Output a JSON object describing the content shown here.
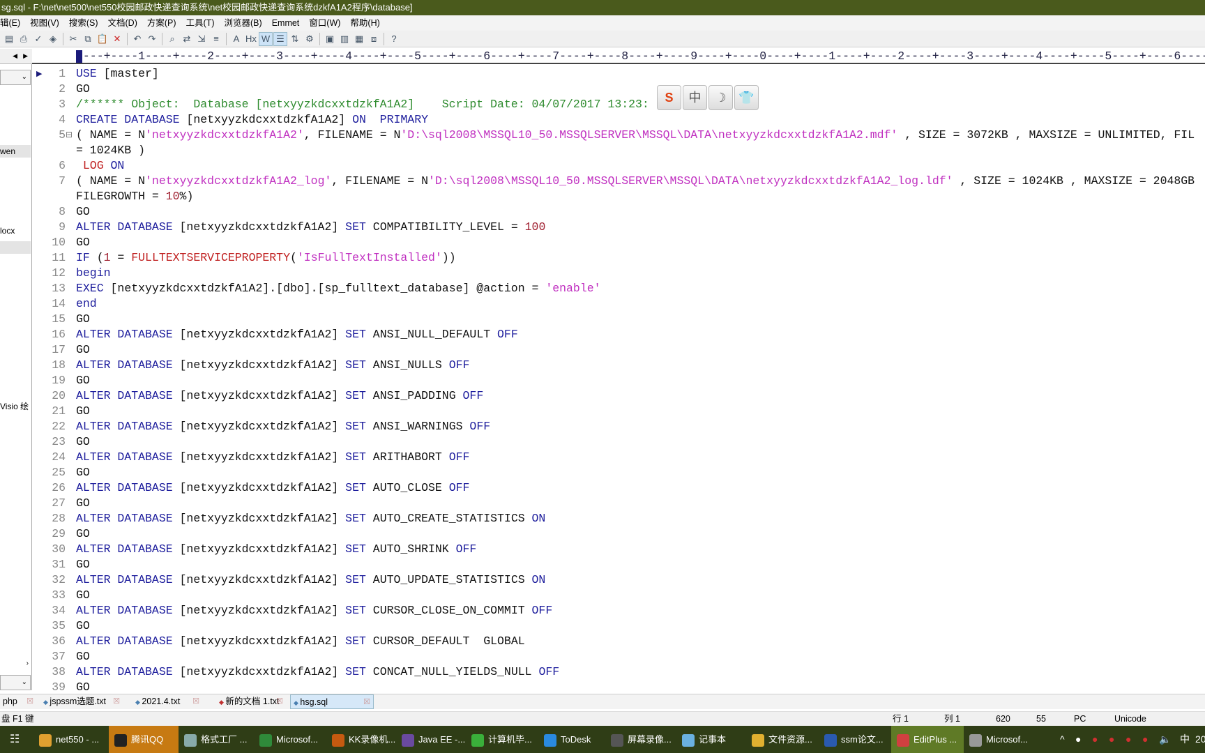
{
  "window": {
    "title": "sg.sql - F:\\net\\net500\\net550校园邮政快递查询系统\\net校园邮政快递查询系统dzkfA1A2程序\\database]"
  },
  "menu": [
    "辑(E)",
    "视图(V)",
    "搜索(S)",
    "文档(D)",
    "方案(P)",
    "工具(T)",
    "浏览器(B)",
    "Emmet",
    "窗口(W)",
    "帮助(H)"
  ],
  "toolbar_icons": [
    "print-preview-icon",
    "print-icon",
    "spellcheck-icon",
    "browser-icon",
    "cut-icon",
    "copy-icon",
    "paste-icon",
    "delete-icon",
    "undo-icon",
    "redo-icon",
    "find-icon",
    "replace-icon",
    "goto-icon",
    "line-number-icon",
    "font-icon",
    "hex-icon",
    "word-wrap-icon",
    "ruler-icon",
    "line-sort-icon",
    "settings-icon",
    "layout-1-icon",
    "layout-2-icon",
    "layout-3-icon",
    "layout-4-icon",
    "help-icon"
  ],
  "left_panel": {
    "items": [
      "wen",
      "locx",
      "Visio 绘"
    ]
  },
  "ruler": "----+----1----+----2----+----3----+----4----+----5----+----6----+----7----+----8----+----9----+----0----+----1----+----2----+----3----+----4----+----5----+----6----",
  "ime_toolbar": [
    "S",
    "中",
    "☽",
    "👕"
  ],
  "code": [
    {
      "n": "1",
      "seg": [
        [
          "k",
          "USE"
        ],
        [
          "t",
          " [master]"
        ]
      ]
    },
    {
      "n": "2",
      "seg": [
        [
          "t",
          "GO"
        ]
      ]
    },
    {
      "n": "3",
      "seg": [
        [
          "c",
          "/****** Object:  Database [netxyyzkdcxxtdzkfA1A2]    Script Date: 04/07/2017 13:23:"
        ]
      ]
    },
    {
      "n": "4",
      "seg": [
        [
          "k",
          "CREATE DATABASE"
        ],
        [
          "t",
          " [netxyyzkdcxxtdzkfA1A2] "
        ],
        [
          "k",
          "ON  PRIMARY"
        ]
      ]
    },
    {
      "n": "5",
      "fold": true,
      "seg": [
        [
          "t",
          "( NAME = N"
        ],
        [
          "s",
          "'netxyyzkdcxxtdzkfA1A2'"
        ],
        [
          "t",
          ", FILENAME = N"
        ],
        [
          "s",
          "'D:\\sql2008\\MSSQL10_50.MSSQLSERVER\\MSSQL\\DATA\\netxyyzkdcxxtdzkfA1A2.mdf'"
        ],
        [
          "t",
          " , SIZE = 3072KB , MAXSIZE = UNLIMITED, FIL"
        ]
      ]
    },
    {
      "n": "",
      "seg": [
        [
          "t",
          "= 1024KB )"
        ]
      ]
    },
    {
      "n": "6",
      "seg": [
        [
          "f",
          " LOG "
        ],
        [
          "k",
          "ON"
        ]
      ]
    },
    {
      "n": "7",
      "seg": [
        [
          "t",
          "( NAME = N"
        ],
        [
          "s",
          "'netxyyzkdcxxtdzkfA1A2_log'"
        ],
        [
          "t",
          ", FILENAME = N"
        ],
        [
          "s",
          "'D:\\sql2008\\MSSQL10_50.MSSQLSERVER\\MSSQL\\DATA\\netxyyzkdcxxtdzkfA1A2_log.ldf'"
        ],
        [
          "t",
          " , SIZE = 1024KB , MAXSIZE = 2048GB"
        ]
      ]
    },
    {
      "n": "",
      "seg": [
        [
          "t",
          "FILEGROWTH = "
        ],
        [
          "n",
          "10"
        ],
        [
          "t",
          "%)"
        ]
      ]
    },
    {
      "n": "8",
      "seg": [
        [
          "t",
          "GO"
        ]
      ]
    },
    {
      "n": "9",
      "seg": [
        [
          "k",
          "ALTER DATABASE"
        ],
        [
          "t",
          " [netxyyzkdcxxtdzkfA1A2] "
        ],
        [
          "k",
          "SET"
        ],
        [
          "t",
          " COMPATIBILITY_LEVEL = "
        ],
        [
          "n",
          "100"
        ]
      ]
    },
    {
      "n": "10",
      "seg": [
        [
          "t",
          "GO"
        ]
      ]
    },
    {
      "n": "11",
      "seg": [
        [
          "k",
          "IF"
        ],
        [
          "t",
          " ("
        ],
        [
          "n",
          "1"
        ],
        [
          "t",
          " = "
        ],
        [
          "f",
          "FULLTEXTSERVICEPROPERTY"
        ],
        [
          "t",
          "("
        ],
        [
          "s",
          "'IsFullTextInstalled'"
        ],
        [
          "t",
          "))"
        ]
      ]
    },
    {
      "n": "12",
      "seg": [
        [
          "k",
          "begin"
        ]
      ]
    },
    {
      "n": "13",
      "seg": [
        [
          "k",
          "EXEC"
        ],
        [
          "t",
          " [netxyyzkdcxxtdzkfA1A2].[dbo].[sp_fulltext_database] @action = "
        ],
        [
          "s",
          "'enable'"
        ]
      ]
    },
    {
      "n": "14",
      "seg": [
        [
          "k",
          "end"
        ]
      ]
    },
    {
      "n": "15",
      "seg": [
        [
          "t",
          "GO"
        ]
      ]
    },
    {
      "n": "16",
      "seg": [
        [
          "k",
          "ALTER DATABASE"
        ],
        [
          "t",
          " [netxyyzkdcxxtdzkfA1A2] "
        ],
        [
          "k",
          "SET"
        ],
        [
          "t",
          " ANSI_NULL_DEFAULT "
        ],
        [
          "k",
          "OFF"
        ]
      ]
    },
    {
      "n": "17",
      "seg": [
        [
          "t",
          "GO"
        ]
      ]
    },
    {
      "n": "18",
      "seg": [
        [
          "k",
          "ALTER DATABASE"
        ],
        [
          "t",
          " [netxyyzkdcxxtdzkfA1A2] "
        ],
        [
          "k",
          "SET"
        ],
        [
          "t",
          " ANSI_NULLS "
        ],
        [
          "k",
          "OFF"
        ]
      ]
    },
    {
      "n": "19",
      "seg": [
        [
          "t",
          "GO"
        ]
      ]
    },
    {
      "n": "20",
      "seg": [
        [
          "k",
          "ALTER DATABASE"
        ],
        [
          "t",
          " [netxyyzkdcxxtdzkfA1A2] "
        ],
        [
          "k",
          "SET"
        ],
        [
          "t",
          " ANSI_PADDING "
        ],
        [
          "k",
          "OFF"
        ]
      ]
    },
    {
      "n": "21",
      "seg": [
        [
          "t",
          "GO"
        ]
      ]
    },
    {
      "n": "22",
      "seg": [
        [
          "k",
          "ALTER DATABASE"
        ],
        [
          "t",
          " [netxyyzkdcxxtdzkfA1A2] "
        ],
        [
          "k",
          "SET"
        ],
        [
          "t",
          " ANSI_WARNINGS "
        ],
        [
          "k",
          "OFF"
        ]
      ]
    },
    {
      "n": "23",
      "seg": [
        [
          "t",
          "GO"
        ]
      ]
    },
    {
      "n": "24",
      "seg": [
        [
          "k",
          "ALTER DATABASE"
        ],
        [
          "t",
          " [netxyyzkdcxxtdzkfA1A2] "
        ],
        [
          "k",
          "SET"
        ],
        [
          "t",
          " ARITHABORT "
        ],
        [
          "k",
          "OFF"
        ]
      ]
    },
    {
      "n": "25",
      "seg": [
        [
          "t",
          "GO"
        ]
      ]
    },
    {
      "n": "26",
      "seg": [
        [
          "k",
          "ALTER DATABASE"
        ],
        [
          "t",
          " [netxyyzkdcxxtdzkfA1A2] "
        ],
        [
          "k",
          "SET"
        ],
        [
          "t",
          " AUTO_CLOSE "
        ],
        [
          "k",
          "OFF"
        ]
      ]
    },
    {
      "n": "27",
      "seg": [
        [
          "t",
          "GO"
        ]
      ]
    },
    {
      "n": "28",
      "seg": [
        [
          "k",
          "ALTER DATABASE"
        ],
        [
          "t",
          " [netxyyzkdcxxtdzkfA1A2] "
        ],
        [
          "k",
          "SET"
        ],
        [
          "t",
          " AUTO_CREATE_STATISTICS "
        ],
        [
          "k",
          "ON"
        ]
      ]
    },
    {
      "n": "29",
      "seg": [
        [
          "t",
          "GO"
        ]
      ]
    },
    {
      "n": "30",
      "seg": [
        [
          "k",
          "ALTER DATABASE"
        ],
        [
          "t",
          " [netxyyzkdcxxtdzkfA1A2] "
        ],
        [
          "k",
          "SET"
        ],
        [
          "t",
          " AUTO_SHRINK "
        ],
        [
          "k",
          "OFF"
        ]
      ]
    },
    {
      "n": "31",
      "seg": [
        [
          "t",
          "GO"
        ]
      ]
    },
    {
      "n": "32",
      "seg": [
        [
          "k",
          "ALTER DATABASE"
        ],
        [
          "t",
          " [netxyyzkdcxxtdzkfA1A2] "
        ],
        [
          "k",
          "SET"
        ],
        [
          "t",
          " AUTO_UPDATE_STATISTICS "
        ],
        [
          "k",
          "ON"
        ]
      ]
    },
    {
      "n": "33",
      "seg": [
        [
          "t",
          "GO"
        ]
      ]
    },
    {
      "n": "34",
      "seg": [
        [
          "k",
          "ALTER DATABASE"
        ],
        [
          "t",
          " [netxyyzkdcxxtdzkfA1A2] "
        ],
        [
          "k",
          "SET"
        ],
        [
          "t",
          " CURSOR_CLOSE_ON_COMMIT "
        ],
        [
          "k",
          "OFF"
        ]
      ]
    },
    {
      "n": "35",
      "seg": [
        [
          "t",
          "GO"
        ]
      ]
    },
    {
      "n": "36",
      "seg": [
        [
          "k",
          "ALTER DATABASE"
        ],
        [
          "t",
          " [netxyyzkdcxxtdzkfA1A2] "
        ],
        [
          "k",
          "SET"
        ],
        [
          "t",
          " CURSOR_DEFAULT  GLOBAL"
        ]
      ]
    },
    {
      "n": "37",
      "seg": [
        [
          "t",
          "GO"
        ]
      ]
    },
    {
      "n": "38",
      "seg": [
        [
          "k",
          "ALTER DATABASE"
        ],
        [
          "t",
          " [netxyyzkdcxxtdzkfA1A2] "
        ],
        [
          "k",
          "SET"
        ],
        [
          "t",
          " CONCAT_NULL_YIELDS_NULL "
        ],
        [
          "k",
          "OFF"
        ]
      ]
    },
    {
      "n": "39",
      "seg": [
        [
          "t",
          "GO"
        ]
      ]
    }
  ],
  "tabs": [
    {
      "label": "php",
      "active": false
    },
    {
      "label": "jspssm选题.txt",
      "active": false
    },
    {
      "label": "2021.4.txt",
      "active": false
    },
    {
      "label": "新的文档 1.txt",
      "active": false
    },
    {
      "label": "hsg.sql",
      "active": true
    }
  ],
  "status": {
    "hint": "盘 F1 键",
    "line": "行 1",
    "col": "列 1",
    "v1": "620",
    "v2": "55",
    "mode": "PC",
    "encoding": "Unicode"
  },
  "taskbar": {
    "items": [
      {
        "label": "net550 - ...",
        "color": "#e0a030"
      },
      {
        "label": "腾讯QQ",
        "color": "#222",
        "active": "qq"
      },
      {
        "label": "格式工厂 ...",
        "color": "#8aa"
      },
      {
        "label": "Microsof...",
        "color": "#2f8a3a"
      },
      {
        "label": "KK录像机...",
        "color": "#c55a10"
      },
      {
        "label": "Java EE -...",
        "color": "#6a4aa0"
      },
      {
        "label": "计算机毕...",
        "color": "#3ab03a"
      },
      {
        "label": "ToDesk",
        "color": "#2a8ae0"
      },
      {
        "label": "屏幕录像...",
        "color": "#555"
      },
      {
        "label": "记事本",
        "color": "#6ab0e0"
      },
      {
        "label": "文件资源...",
        "color": "#e0b030"
      },
      {
        "label": "ssm论文...",
        "color": "#2a5ab0"
      },
      {
        "label": "EditPlus ...",
        "color": "#d04040",
        "active": "ep"
      },
      {
        "label": "Microsof...",
        "color": "#999"
      }
    ],
    "tray": {
      "chevron": "^",
      "ime": "中",
      "clock": "20"
    }
  },
  "colors": {
    "keyword": "#1c1c9c",
    "string": "#c030c0",
    "comment": "#2e8b2e",
    "number": "#a02030",
    "function": "#c02020"
  }
}
